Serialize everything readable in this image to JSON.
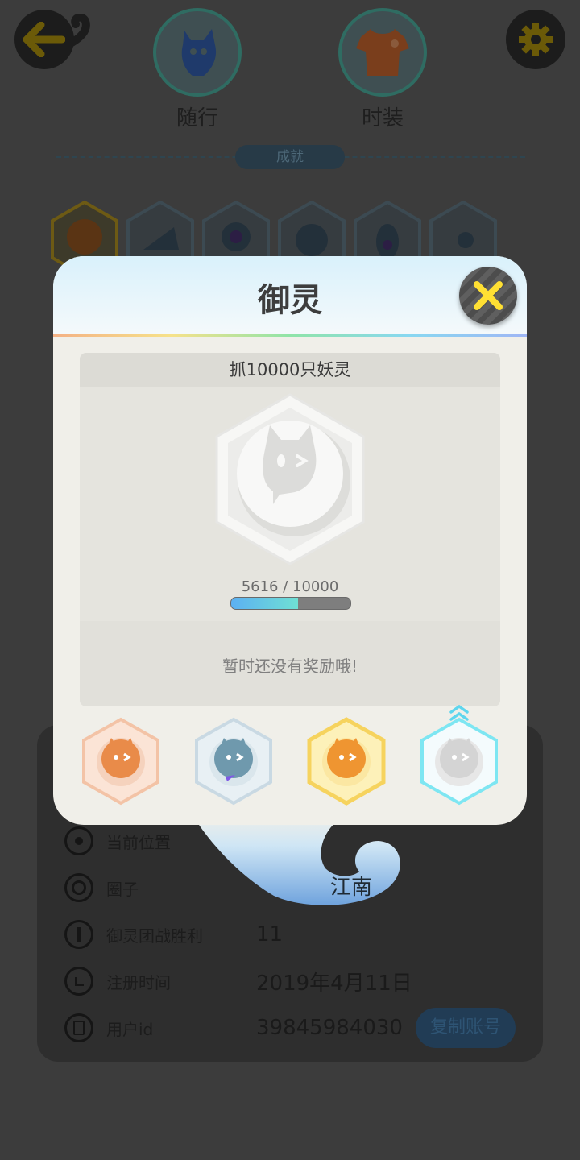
{
  "header": {
    "back_icon": "back-arrow-icon",
    "settings_icon": "gear-icon",
    "tabs": [
      {
        "label": "随行",
        "icon": "companion-creature-icon"
      },
      {
        "label": "时装",
        "icon": "shirt-icon"
      }
    ]
  },
  "achievements": {
    "section_label": "成就"
  },
  "profile": {
    "rows": [
      {
        "icon": "location-pin-icon",
        "label": "当前位置",
        "value": ""
      },
      {
        "icon": "circle-target-icon",
        "label": "圈子",
        "value": "江南"
      },
      {
        "icon": "team-battle-icon",
        "label": "御灵团战胜利",
        "value": "11"
      },
      {
        "icon": "clock-icon",
        "label": "注册时间",
        "value": "2019年4月11日"
      },
      {
        "icon": "user-id-icon",
        "label": "用户id",
        "value": "39845984030"
      }
    ],
    "copy_button": "复制账号"
  },
  "modal": {
    "title": "御灵",
    "close_icon": "close-x-icon",
    "task": "抓10000只妖灵",
    "progress_text": "5616 / 10000",
    "progress_value": 5616,
    "progress_max": 10000,
    "reward_text": "暂时还没有奖励哦!",
    "tiers": [
      {
        "name": "bronze",
        "color": "#f0a97a",
        "icon": "bronze-spirit-badge-icon"
      },
      {
        "name": "silver",
        "color": "#a9c3d4",
        "icon": "silver-spirit-badge-icon"
      },
      {
        "name": "gold",
        "color": "#f6d35e",
        "icon": "gold-spirit-badge-icon"
      },
      {
        "name": "diamond",
        "color": "#7ee6f2",
        "icon": "diamond-spirit-badge-icon",
        "selected": true
      }
    ]
  },
  "colors": {
    "accent_yellow": "#ffe033",
    "progress_blue": "#5cb0f2",
    "progress_teal": "#6fe0d4"
  }
}
